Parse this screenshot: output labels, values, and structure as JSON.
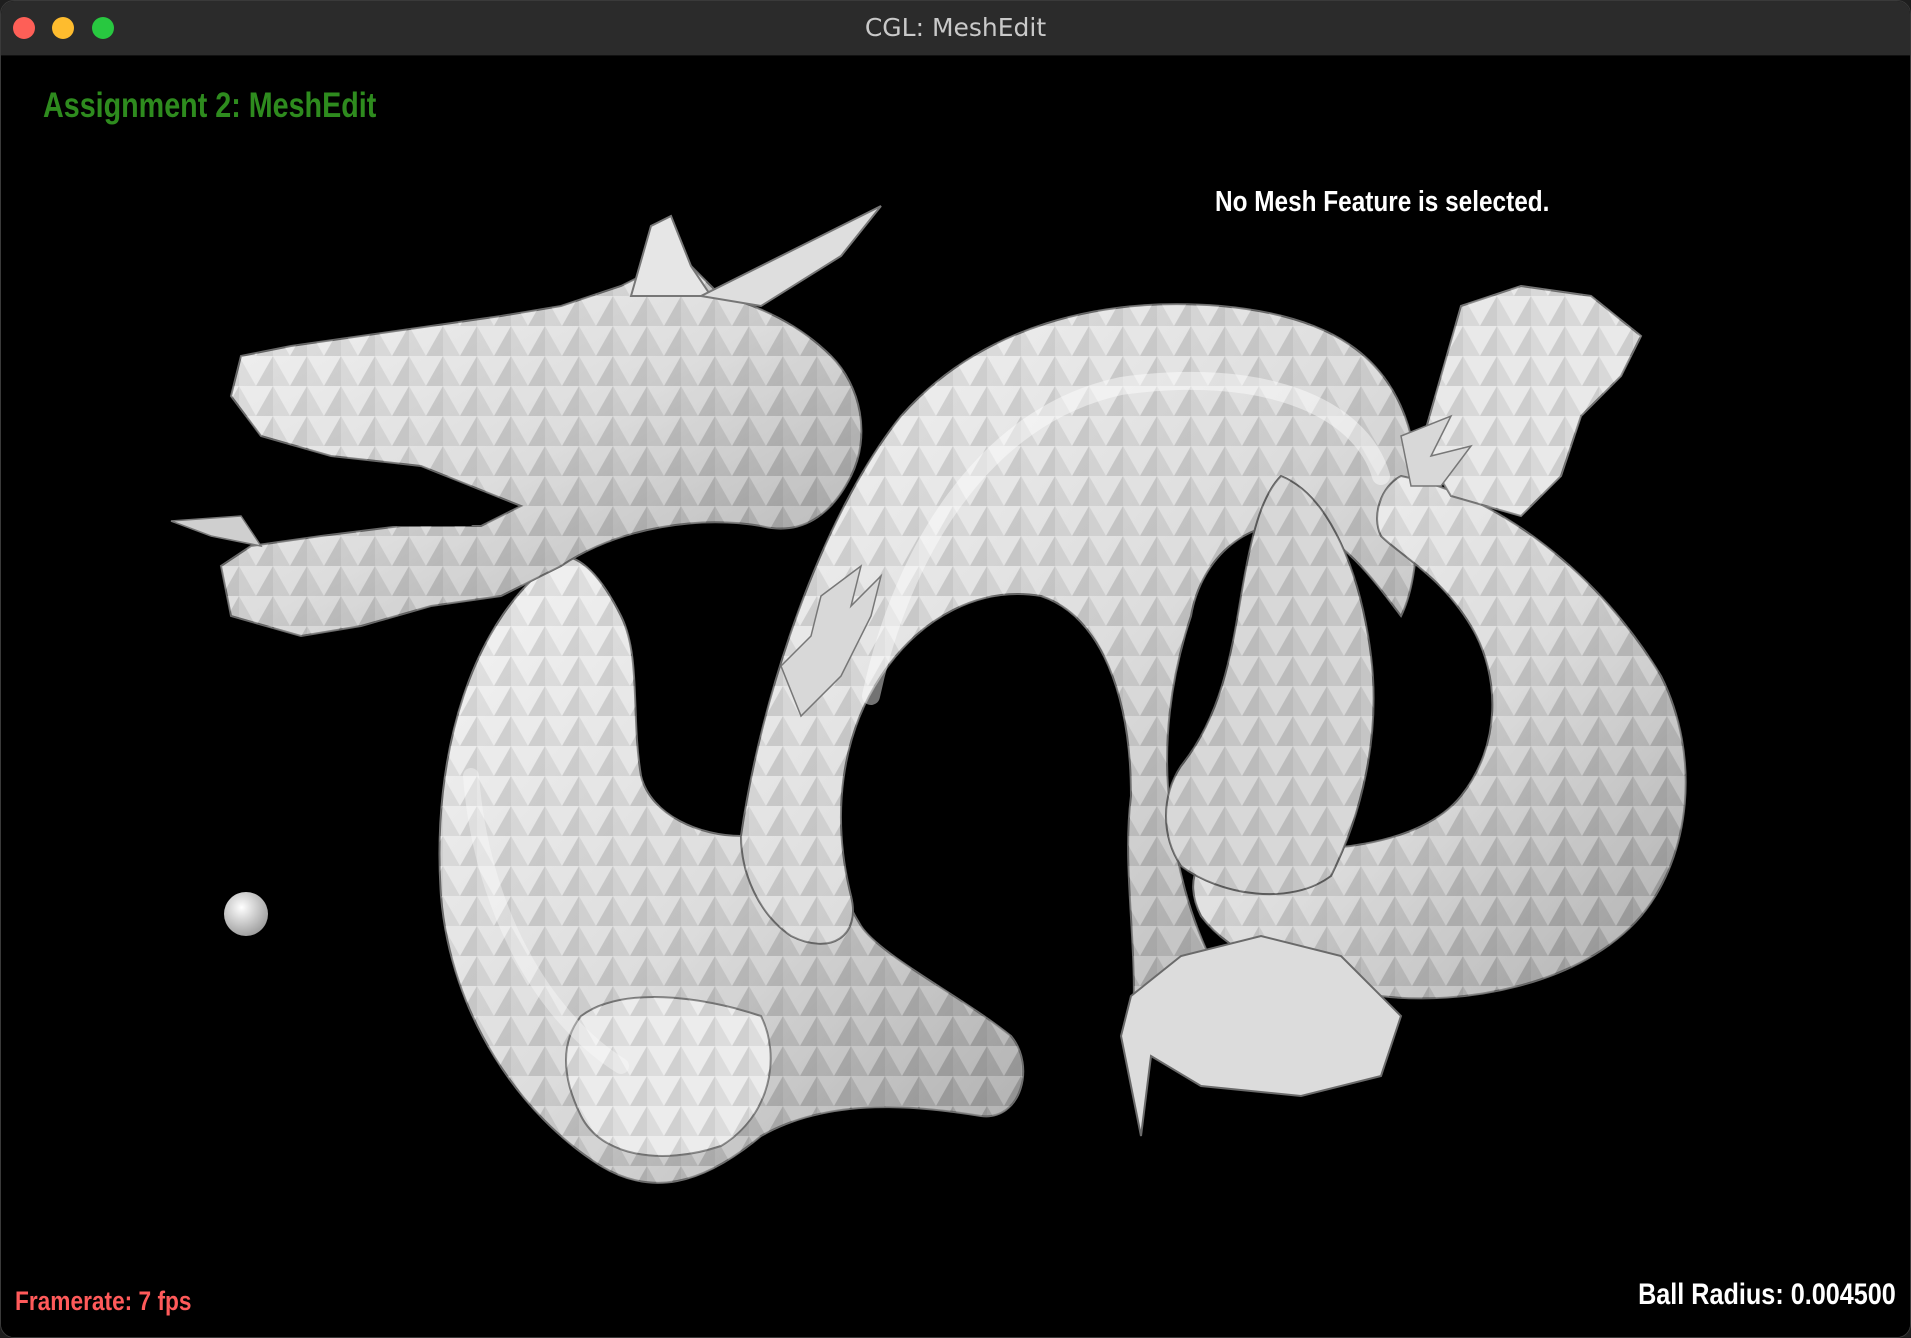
{
  "window": {
    "title": "CGL: MeshEdit",
    "controls": [
      "close",
      "minimize",
      "zoom"
    ]
  },
  "hud": {
    "assignment_title": "Assignment 2: MeshEdit",
    "selection_status": "No Mesh Feature is selected.",
    "framerate": "Framerate: 7 fps",
    "ball_radius": "Ball Radius: 0.004500"
  },
  "colors": {
    "title_green": "#2e8b1e",
    "framerate_red": "#ff5a5a",
    "text_white": "#ffffff",
    "background": "#000000",
    "mesh_base": "#d8d8d8"
  }
}
